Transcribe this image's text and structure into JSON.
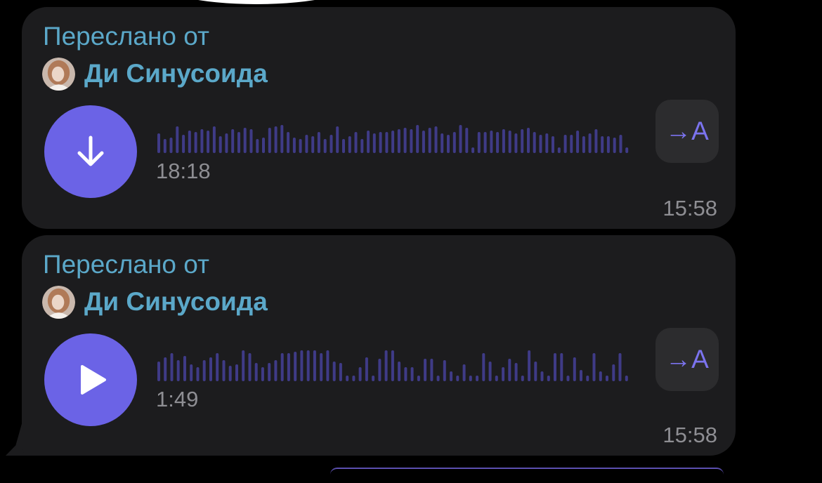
{
  "messages": [
    {
      "forwarded_label": "Переслано от",
      "sender_name": "Ди Синусоида",
      "action_icon": "download-icon",
      "duration": "18:18",
      "transcribe_label": "→A",
      "time": "15:58"
    },
    {
      "forwarded_label": "Переслано от",
      "sender_name": "Ди Синусоида",
      "action_icon": "play-icon",
      "duration": "1:49",
      "transcribe_label": "→A",
      "time": "15:58"
    }
  ],
  "colors": {
    "background": "#000000",
    "bubble": "#1c1c1e",
    "accent": "#6b63e6",
    "name_link": "#5ba8c9",
    "waveform": "#3f3b87",
    "secondary_text": "#8e8e93"
  }
}
